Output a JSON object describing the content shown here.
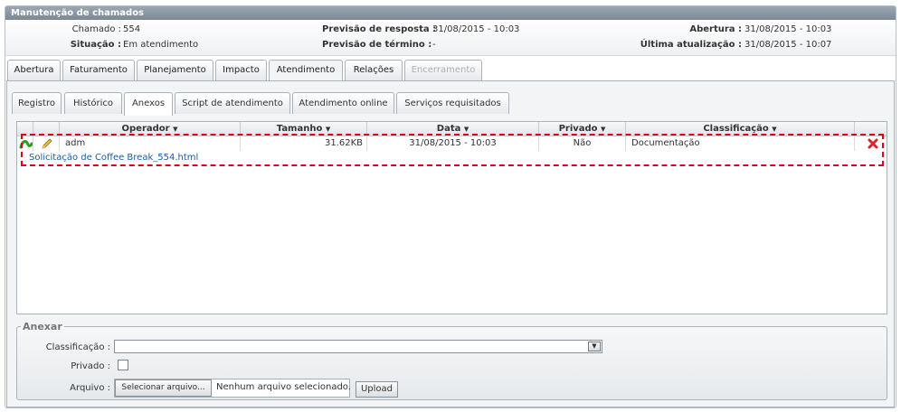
{
  "window": {
    "title": "Manutenção de chamados"
  },
  "info": {
    "chamado_label": "Chamado :",
    "chamado_value": "554",
    "situacao_label": "Situação :",
    "situacao_value": "Em atendimento",
    "prev_resposta_label": "Previsão de resposta :",
    "prev_resposta_value": "31/08/2015 - 10:03",
    "prev_termino_label": "Previsão de término :",
    "prev_termino_value": "-",
    "abertura_label": "Abertura :",
    "abertura_value": "31/08/2015 - 10:03",
    "ultima_label": "Última atualização :",
    "ultima_value": "31/08/2015 - 10:07"
  },
  "tabs": [
    "Abertura",
    "Faturamento",
    "Planejamento",
    "Impacto",
    "Atendimento",
    "Relações",
    "Encerramento"
  ],
  "subtabs": [
    "Registro",
    "Histórico",
    "Anexos",
    "Script de atendimento",
    "Atendimento online",
    "Serviços requisitados"
  ],
  "grid": {
    "headers": {
      "operador": "Operador",
      "tamanho": "Tamanho",
      "data": "Data",
      "privado": "Privado",
      "classificacao": "Classificação"
    },
    "rows": [
      {
        "operador": "adm",
        "tamanho": "31.62KB",
        "data": "31/08/2015 - 10:03",
        "privado": "Não",
        "classificacao": "Documentação",
        "arquivo": "Solicitação de Coffee Break_554.html"
      }
    ]
  },
  "anexar": {
    "legend": "Anexar",
    "classificacao_label": "Classificação :",
    "classificacao_value": "",
    "privado_label": "Privado :",
    "arquivo_label": "Arquivo :",
    "select_file_button": "Selecionar arquivo...",
    "no_file_text": "Nenhum arquivo selecionado.",
    "upload_button": "Upload"
  },
  "colors": {
    "title_bar": "#8a96a2",
    "highlight_border": "#e0001a",
    "link": "#1a5da1"
  },
  "icons": [
    "download-icon",
    "edit-pencil-icon",
    "delete-icon",
    "sort-arrow-icon",
    "dropdown-arrow-icon"
  ]
}
